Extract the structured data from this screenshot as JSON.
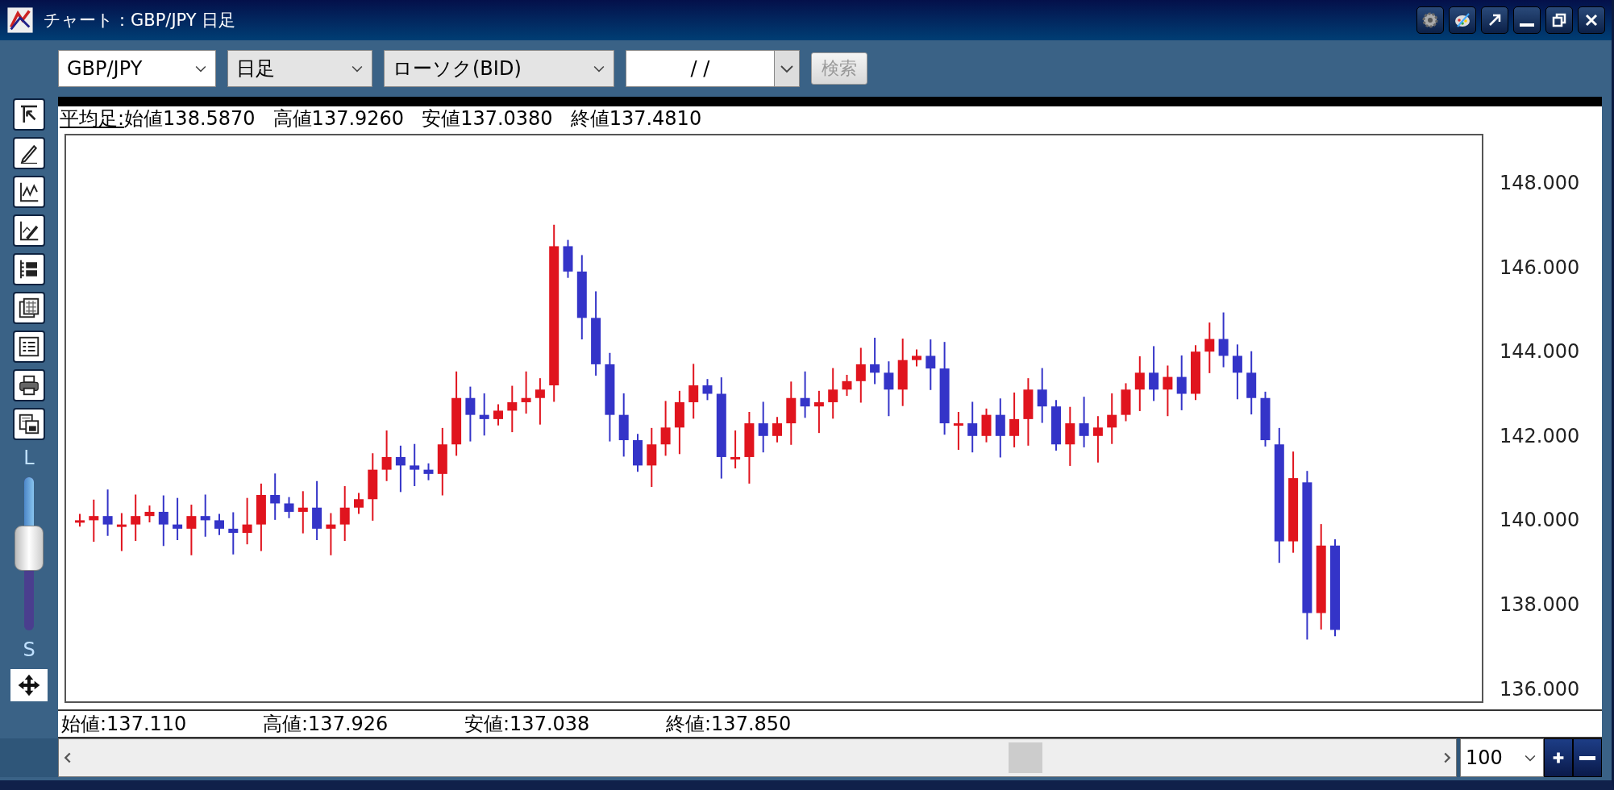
{
  "window": {
    "title": "チャート：GBP/JPY 日足"
  },
  "toolbar": {
    "dropdowns": [
      {
        "value": "GBP/JPY"
      },
      {
        "value": "日足"
      },
      {
        "value": "ローソク(BID)"
      }
    ],
    "date_field": {
      "value": "/ /"
    },
    "search_button": {
      "label": "検索",
      "disabled": true
    }
  },
  "side_slider": {
    "top_label": "L",
    "bottom_label": "S",
    "level": 0.55
  },
  "info_bar": {
    "label": "平均足:",
    "values": [
      "始値138.5870",
      "高値137.9260",
      "安値137.0380",
      "終値137.4810"
    ]
  },
  "y_axis_labels": [
    "148.000",
    "146.000",
    "144.000",
    "142.000",
    "140.000",
    "138.000",
    "136.000"
  ],
  "ohlc_bar": [
    "始値:137.110",
    "高値:137.926",
    "安値:137.038",
    "終値:137.850"
  ],
  "zoom_select": {
    "value": "100"
  }
}
